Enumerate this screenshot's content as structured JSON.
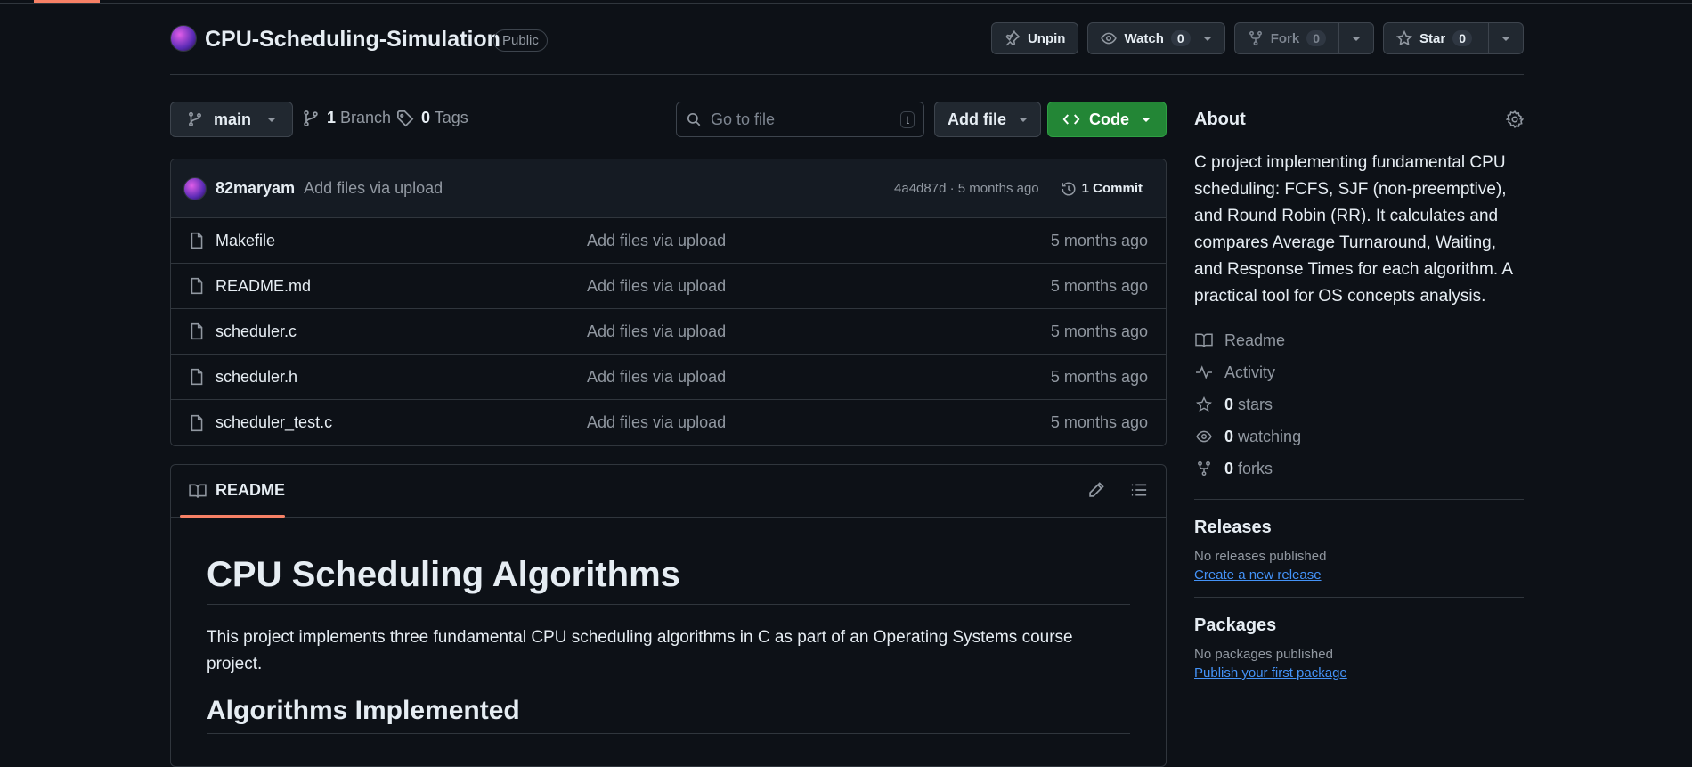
{
  "repo": {
    "name": "CPU-Scheduling-Simulation",
    "visibility": "Public",
    "unpin_label": "Unpin",
    "watch_label": "Watch",
    "watch_count": "0",
    "fork_label": "Fork",
    "fork_count": "0",
    "star_label": "Star",
    "star_count": "0"
  },
  "toolbar": {
    "branch": "main",
    "branch_count": "1",
    "branch_label": "Branch",
    "tag_count": "0",
    "tag_label": "Tags",
    "search_placeholder": "Go to file",
    "search_shortcut": "t",
    "add_file_label": "Add file",
    "code_label": "Code"
  },
  "commit": {
    "author": "82maryam",
    "message": "Add files via upload",
    "hash_time": "4a4d87d · 5 months ago",
    "commit_count": "1 Commit"
  },
  "files": [
    {
      "name": "Makefile",
      "message": "Add files via upload",
      "time": "5 months ago"
    },
    {
      "name": "README.md",
      "message": "Add files via upload",
      "time": "5 months ago"
    },
    {
      "name": "scheduler.c",
      "message": "Add files via upload",
      "time": "5 months ago"
    },
    {
      "name": "scheduler.h",
      "message": "Add files via upload",
      "time": "5 months ago"
    },
    {
      "name": "scheduler_test.c",
      "message": "Add files via upload",
      "time": "5 months ago"
    }
  ],
  "readme": {
    "tab_label": "README",
    "h1": "CPU Scheduling Algorithms",
    "intro": "This project implements three fundamental CPU scheduling algorithms in C as part of an Operating Systems course project.",
    "h2": "Algorithms Implemented"
  },
  "about": {
    "title": "About",
    "description": "C project implementing fundamental CPU scheduling: FCFS, SJF (non-preemptive), and Round Robin (RR). It calculates and compares Average Turnaround, Waiting, and Response Times for each algorithm. A practical tool for OS concepts analysis.",
    "readme_label": "Readme",
    "activity_label": "Activity",
    "stars_count": "0",
    "stars_label": "stars",
    "watching_count": "0",
    "watching_label": "watching",
    "forks_count": "0",
    "forks_label": "forks"
  },
  "releases": {
    "title": "Releases",
    "empty": "No releases published",
    "link": "Create a new release"
  },
  "packages": {
    "title": "Packages",
    "empty": "No packages published",
    "link": "Publish your first package"
  },
  "colors": {
    "background": "#0d1117",
    "border": "#30363d",
    "accent": "#f78166",
    "link": "#4493f8",
    "code_button": "#238636"
  }
}
